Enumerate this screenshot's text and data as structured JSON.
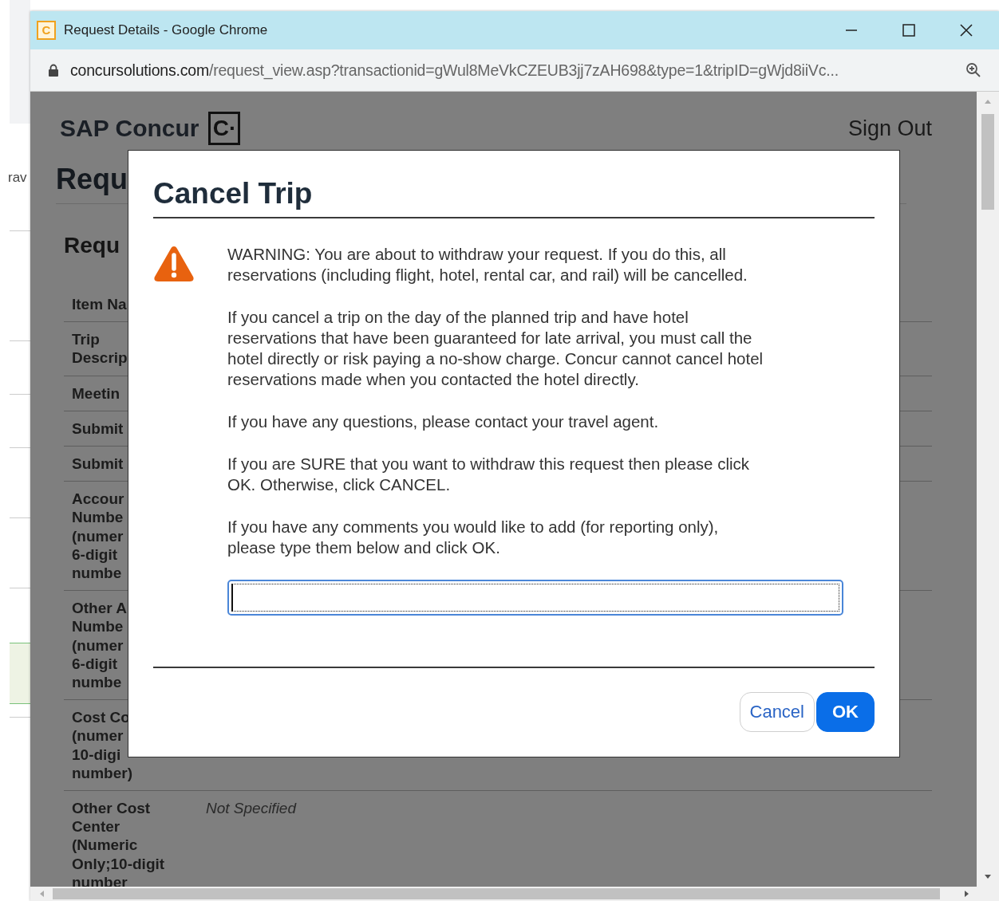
{
  "background_page": {
    "text": "rav"
  },
  "window": {
    "title": "Request Details - Google Chrome",
    "favicon": "C"
  },
  "address_bar": {
    "domain": "concursolutions.com",
    "path": "/request_view.asp?transactionid=gWul8MeVkCZEUB3jj7zAH698&type=1&tripID=gWjd8iiVc..."
  },
  "page": {
    "logo": {
      "text": "SAP Concur",
      "mark": "C·"
    },
    "sign_out": "Sign Out",
    "heading": "Requ",
    "section_heading": "Requ",
    "rows": [
      {
        "label": "Item Na"
      },
      {
        "label": "Trip\nDescrip"
      },
      {
        "label": "Meetin"
      },
      {
        "label": "Submit"
      },
      {
        "label": "Submit"
      },
      {
        "label": "Accour\nNumbe\n(numer\n6-digit\nnumbe"
      },
      {
        "label": "Other A\nNumbe\n(numer\n6-digit\nnumbe"
      },
      {
        "label": "Cost Co\n(numer\n10-digi\nnumber)"
      },
      {
        "label": "Other Cost\nCenter\n(Numeric\nOnly;10-digit\nnumber",
        "value": "Not Specified"
      }
    ]
  },
  "dialog": {
    "title": "Cancel Trip",
    "paragraphs": [
      "WARNING: You are about to withdraw your request. If you do this, all\nreservations (including flight, hotel, rental car, and rail) will be cancelled.",
      "If you cancel a trip on the day of the planned trip and have hotel\nreservations that have been guaranteed for late arrival, you must call the\nhotel directly or risk paying a no-show charge. Concur cannot cancel hotel\nreservations made when you contacted the hotel directly.",
      "If you have any questions, please contact your travel agent.",
      "If you are SURE that you want to withdraw this request then please click\nOK. Otherwise, click CANCEL.",
      "If you have any comments you would like to add (for reporting only),\nplease type them below and click OK."
    ],
    "comment_field": {
      "focused": true
    },
    "buttons": [
      {
        "label": "Cancel",
        "kind": "secondary"
      },
      {
        "label": "OK",
        "kind": "primary"
      }
    ]
  }
}
